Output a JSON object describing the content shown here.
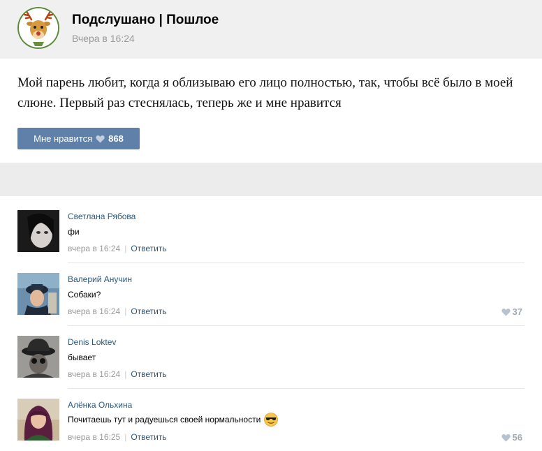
{
  "post": {
    "group_name": "Подслушано | Пошлое",
    "time": "Вчера в 16:24",
    "text": "Мой парень любит, когда я облизываю его лицо полностью, так, чтобы всё было в моей слюне. Первый раз стеснялась, теперь же и мне нравится",
    "like_label": "Мне нравится",
    "like_count": "868"
  },
  "comments": [
    {
      "author": "Светлана Рябова",
      "text": "фи",
      "time": "вчера в 16:24",
      "reply": "Ответить",
      "likes": ""
    },
    {
      "author": "Валерий Анучин",
      "text": "Собаки?",
      "time": "вчера в 16:24",
      "reply": "Ответить",
      "likes": "37"
    },
    {
      "author": "Denis Loktev",
      "text": "бывает",
      "time": "вчера в 16:24",
      "reply": "Ответить",
      "likes": ""
    },
    {
      "author": "Алёнка Ольхина",
      "text": "Почитаешь тут и радуешься своей нормальности",
      "time": "вчера в 16:25",
      "reply": "Ответить",
      "likes": "56"
    }
  ],
  "colors": {
    "link": "#2b587a",
    "like_button": "#5f80a8",
    "header_bg": "#f0f0f0",
    "meta": "#999999"
  },
  "icons": [
    "reindeer-avatar",
    "heart-icon",
    "sunglasses-emoji"
  ]
}
